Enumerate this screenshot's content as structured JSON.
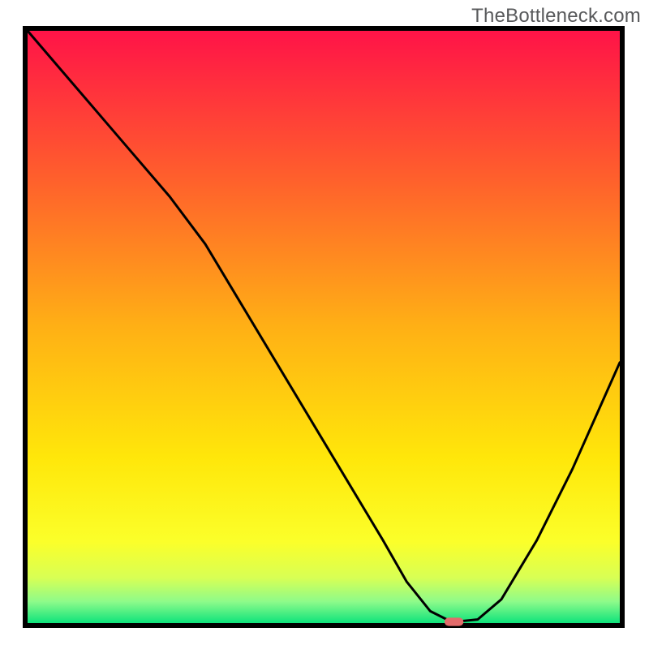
{
  "watermark": "TheBottleneck.com",
  "chart_data": {
    "type": "line",
    "title": "",
    "xlabel": "",
    "ylabel": "",
    "xlim": [
      0,
      100
    ],
    "ylim": [
      0,
      100
    ],
    "grid": false,
    "legend": false,
    "axes_visible": false,
    "background_gradient": {
      "direction": "vertical_top_to_bottom",
      "stops": [
        {
          "pos": 0.0,
          "color": "#ff1248"
        },
        {
          "pos": 0.25,
          "color": "#ff5f2c"
        },
        {
          "pos": 0.5,
          "color": "#ffb015"
        },
        {
          "pos": 0.72,
          "color": "#ffe70a"
        },
        {
          "pos": 0.86,
          "color": "#fbff2a"
        },
        {
          "pos": 0.92,
          "color": "#d8ff54"
        },
        {
          "pos": 0.96,
          "color": "#8efb8a"
        },
        {
          "pos": 1.0,
          "color": "#00e07a"
        }
      ]
    },
    "series": [
      {
        "name": "bottleneck_curve",
        "x": [
          0,
          6,
          12,
          18,
          24,
          30,
          36,
          42,
          48,
          54,
          60,
          64,
          68,
          71,
          73,
          76,
          80,
          86,
          92,
          100
        ],
        "y": [
          100,
          93,
          86,
          79,
          72,
          64,
          54,
          44,
          34,
          24,
          14,
          7,
          2,
          0.5,
          0.3,
          0.6,
          4,
          14,
          26,
          44
        ],
        "stroke": "#000000",
        "stroke_width": 3
      }
    ],
    "marker": {
      "name": "optimal_point",
      "x": 72,
      "y": 0.2,
      "shape": "pill",
      "width_pct": 3.2,
      "height_pct": 1.4,
      "fill": "#e36b6b"
    },
    "frame": {
      "stroke": "#000000",
      "stroke_width": 6
    }
  }
}
